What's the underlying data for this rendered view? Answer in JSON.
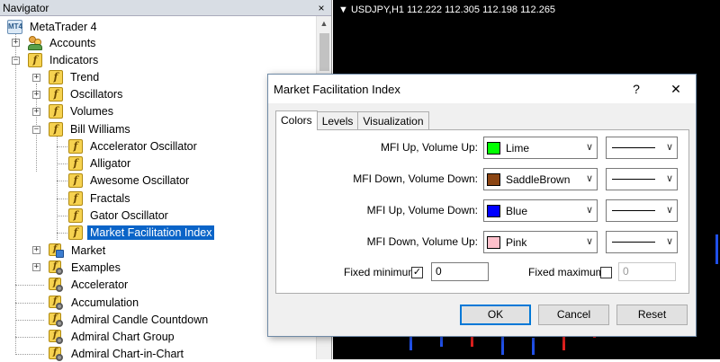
{
  "navigator": {
    "title": "Navigator",
    "close": "×",
    "root": "MetaTrader 4",
    "root_icon": "MT4",
    "items": {
      "accounts": "Accounts",
      "indicators": "Indicators",
      "trend": "Trend",
      "oscillators": "Oscillators",
      "volumes": "Volumes",
      "bill_williams": "Bill Williams",
      "accelerator_oscillator": "Accelerator Oscillator",
      "alligator": "Alligator",
      "awesome_oscillator": "Awesome Oscillator",
      "fractals": "Fractals",
      "gator_oscillator": "Gator Oscillator",
      "market_facilitation_index": "Market Facilitation Index",
      "market": "Market",
      "examples": "Examples",
      "accelerator": "Accelerator",
      "accumulation": "Accumulation",
      "admiral_candle_countdown": "Admiral Candle Countdown",
      "admiral_chart_group": "Admiral Chart Group",
      "admiral_chart_in_chart": "Admiral Chart-in-Chart"
    },
    "icon_glyph": "f"
  },
  "chart": {
    "title": "▼ USDJPY,H1  112.222 112.305 112.198 112.265",
    "candles": [
      {
        "t": 0.0,
        "dir": "down",
        "o": 0.08,
        "c": 0.02
      },
      {
        "t": 0.1,
        "dir": "down",
        "o": 0.07,
        "c": 0.03
      },
      {
        "t": 0.2,
        "dir": "up",
        "o": 0.03,
        "c": 0.06
      },
      {
        "t": 0.3,
        "dir": "down",
        "o": 0.06,
        "c": 0.01
      },
      {
        "t": 0.4,
        "dir": "down",
        "o": 0.05,
        "c": 0.01
      },
      {
        "t": 0.5,
        "dir": "up",
        "o": 0.02,
        "c": 0.1
      },
      {
        "t": 0.6,
        "dir": "up",
        "o": 0.05,
        "c": 0.12
      },
      {
        "t": 0.7,
        "dir": "down",
        "o": 0.25,
        "c": 0.15
      },
      {
        "t": 0.8,
        "dir": "down",
        "o": 0.3,
        "c": 0.2
      },
      {
        "t": 0.9,
        "dir": "up",
        "o": 0.2,
        "c": 0.28
      },
      {
        "t": 1.0,
        "dir": "down",
        "o": 0.29,
        "c": 0.22
      }
    ],
    "up_color": "#e0201e",
    "down_color": "#2050e8"
  },
  "dialog": {
    "title": "Market Facilitation Index",
    "help": "?",
    "close": "✕",
    "tabs": [
      "Colors",
      "Levels",
      "Visualization"
    ],
    "rows": [
      {
        "label": "MFI Up, Volume Up:",
        "color_name": "Lime",
        "color": "#00ff00"
      },
      {
        "label": "MFI Down, Volume Down:",
        "color_name": "SaddleBrown",
        "color": "#8b4513"
      },
      {
        "label": "MFI Up, Volume Down:",
        "color_name": "Blue",
        "color": "#0000ff"
      },
      {
        "label": "MFI Down, Volume Up:",
        "color_name": "Pink",
        "color": "#ffc0cb"
      }
    ],
    "fixed_min": {
      "label": "Fixed minimum",
      "checked": "✓",
      "value": "0"
    },
    "fixed_max": {
      "label": "Fixed maximum",
      "checked": "",
      "value": "0"
    },
    "buttons": {
      "ok": "OK",
      "cancel": "Cancel",
      "reset": "Reset"
    }
  }
}
